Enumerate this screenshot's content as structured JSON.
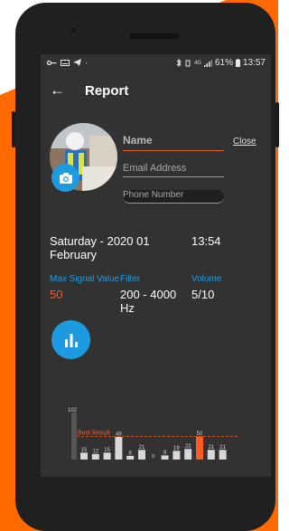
{
  "statusbar": {
    "icons_left": [
      "key-icon",
      "keyboard-icon",
      "telegram-icon"
    ],
    "icons_right": [
      "bluetooth-icon",
      "vibrate-icon",
      "signal-icon",
      "battery-icon"
    ],
    "network": "4G",
    "battery": "61%",
    "clock": "13:57"
  },
  "header": {
    "title": "Report"
  },
  "form": {
    "name_placeholder": "Name",
    "email_placeholder": "Email Address",
    "phone_placeholder": "Phone Number",
    "close_label": "Close"
  },
  "measurement": {
    "date": "Saturday - 2020  01 February",
    "time": "13:54",
    "max_signal_label": "Max Signal Value",
    "max_signal_value": "50",
    "filter_label": "Filter",
    "filter_value": "200 - 4000 Hz",
    "volume_label": "Volume",
    "volume_value": "5/10"
  },
  "chart_data": {
    "type": "bar",
    "annotation": "Best Result",
    "max_label": "102",
    "values": [
      15,
      12,
      15,
      49,
      8,
      21,
      0,
      9,
      19,
      23,
      50,
      21,
      21
    ],
    "highlight_index": 10,
    "colors": {
      "bar": "#d8d8d8",
      "best": "#ff5a1f",
      "back": "#555555"
    }
  },
  "colors": {
    "accent_blue": "#1e9be0",
    "accent_orange": "#ff5a1f",
    "screen_bg": "#323232"
  }
}
